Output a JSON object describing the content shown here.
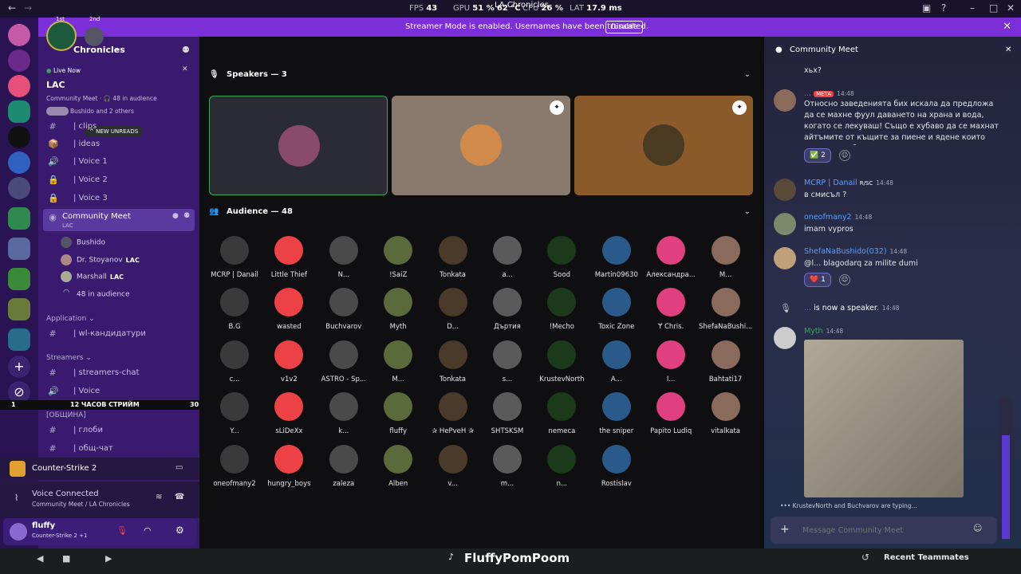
{
  "overlay": {
    "fps_label": "FPS",
    "fps": "43",
    "gpu_label": "GPU",
    "gpu": "51 %",
    "gpu_temp": "62 °C",
    "cpu_label": "CPU",
    "cpu": "26 %",
    "lat_label": "LAT",
    "lat": "17.9 ms",
    "window_title": "LA Chronicles"
  },
  "banner": {
    "text": "Streamer Mode is enabled. Usernames have been truncated.",
    "button": "Disable"
  },
  "server": {
    "name": "Chronicles",
    "rank1": "1st",
    "rank2": "2nd",
    "live_label": "Live Now",
    "live_title": "LAC",
    "live_meta": "Community Meet · 🎧 48 in audience",
    "live_users": "Bushido and 2 others",
    "new_unreads": "NEW UNREADS"
  },
  "channels": [
    {
      "icon": "#",
      "name": "| clips"
    },
    {
      "icon": "📦",
      "name": "| ideas"
    },
    {
      "icon": "🔊",
      "name": "| Voice 1"
    },
    {
      "icon": "🔒",
      "name": "| Voice 2"
    },
    {
      "icon": "🔒",
      "name": "| Voice 3"
    }
  ],
  "stage": {
    "name": "Community Meet",
    "sub": "LAC",
    "speakers": [
      {
        "name": "Bushido",
        "tag": ""
      },
      {
        "name": "Dr. Stoyanov",
        "tag": "LAC"
      },
      {
        "name": "Marshall",
        "tag": "LAC"
      }
    ],
    "audience": "48 in audience"
  },
  "categories": {
    "application": "Application",
    "streamers": "Streamers",
    "community": "[ОБЩИНА]"
  },
  "channels2": [
    {
      "icon": "#",
      "name": "| wl-кандидатури"
    },
    {
      "icon": "#",
      "name": "| streamers-chat"
    },
    {
      "icon": "🔊",
      "name": "| Voice"
    },
    {
      "icon": "#",
      "name": "| глоби"
    },
    {
      "icon": "#",
      "name": "| общ-чат"
    }
  ],
  "stream_strip": {
    "left": "1",
    "center": "12 ЧАСОВ СТРИЙМ",
    "right": "30"
  },
  "game": {
    "name": "Counter-Strike 2"
  },
  "voice": {
    "status": "Voice Connected",
    "where": "Community Meet / LA Chronicles"
  },
  "user": {
    "name": "fluffy",
    "activity": "Counter-Strike 2 +1"
  },
  "main": {
    "speakers_title": "Speakers — 3",
    "audience_title": "Audience — 48"
  },
  "audience": [
    "MCRP | Danail",
    "Little Thief",
    "N...",
    "!SaiZ",
    "Tonkata",
    "a...",
    "Sood",
    "Martin09630",
    "Александра...",
    "M...",
    "B.G",
    "wasted",
    "Buchvarov",
    "Myth",
    "D...",
    "Дъртия",
    "!Mecho",
    "Toxic Zone",
    "Ɏ Chris.",
    "ShefaNaBushi...",
    "c...",
    "v1v2",
    "ASTRO - Sp...",
    "M...",
    "Tonkata",
    "s...",
    "KrustevNorth",
    "A...",
    "I...",
    "Bahtati17",
    "Y...",
    "sLiDeXx",
    "k...",
    "fluffy",
    "✰ НеРvеН ✰",
    "SHTSKSM",
    "nemeca",
    "the sniper",
    "Papito Ludiq",
    "vitalkata",
    "oneofmany2",
    "hungry_boys",
    "zaleza",
    "Alben",
    "v...",
    "m...",
    "n...",
    "Rostislav"
  ],
  "side": {
    "title": "Community Meet",
    "top_text": "хьх?",
    "messages": [
      {
        "user": "...",
        "tag": "META",
        "time": "14:48",
        "text": "Относно заведенията бих искала да предложа да се махне фуул даването на храна и вода, когато се лекуваш! Също е хубаво да се махнат айтъмите от къщите за пиене и ядене които нямат дюрабилити...",
        "reaction": "✅",
        "count": "2"
      },
      {
        "user": "MCRP | Danail",
        "tag": "R/SC",
        "time": "14:48",
        "text": "в смисъл ?"
      },
      {
        "user": "oneofmany2",
        "time": "14:48",
        "text": "imam vypros"
      },
      {
        "user": "ShefaNaBushido(032)",
        "time": "14:48",
        "text": "@l... blagodarq za milite dumi",
        "reaction": "❤️",
        "count": "1"
      },
      {
        "user": "...",
        "time": "14:48",
        "text": "is now a speaker."
      },
      {
        "user": "Myth",
        "time": "14:48",
        "text": ""
      }
    ],
    "typing": "KrustevNorth and Buchvarov are typing...",
    "composer_placeholder": "Message Community Meet"
  },
  "bottom": {
    "brand": "FluffyPomPoom",
    "recent": "Recent Teammates"
  },
  "colors": {
    "accent": "#7b2fd9",
    "sidebar": "#3a1a6e",
    "speaker_border": "#3ba55d"
  }
}
